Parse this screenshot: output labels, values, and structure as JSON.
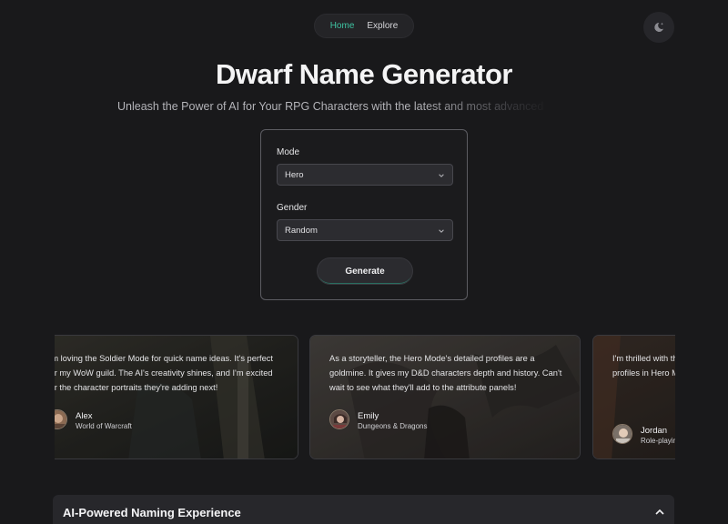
{
  "nav": {
    "links": [
      "Home",
      "Explore"
    ],
    "active": "Home"
  },
  "theme_toggle": {
    "icon": "moon-sparkle-icon"
  },
  "hero": {
    "title": "Dwarf Name Generator",
    "subtitle": "Unleash the Power of AI for Your RPG Characters with the latest and most advanced"
  },
  "form": {
    "mode_label": "Mode",
    "mode_value": "Hero",
    "gender_label": "Gender",
    "gender_value": "Random",
    "generate_label": "Generate"
  },
  "testimonials": [
    {
      "text": "I'm loving the Soldier Mode for quick name ideas. It's perfect for my WoW guild. The AI's creativity shines, and I'm excited for the character portraits they're adding next!",
      "name": "Alex",
      "source": "World of Warcraft"
    },
    {
      "text": "As a storyteller, the Hero Mode's detailed profiles are a goldmine. It gives my D&D characters depth and history. Can't wait to see what they'll add to the attribute panels!",
      "name": "Emily",
      "source": "Dungeons & Dragons"
    },
    {
      "text": "I'm thrilled with the customization. It's made custom names and profiles in Hero Mode a joy to my gameplay.",
      "name": "Jordan",
      "source": "Role-playing"
    }
  ],
  "accordion": {
    "title": "AI-Powered Naming Experience",
    "icon": "chevron-up-icon"
  },
  "colors": {
    "accent": "#3fc4a3",
    "background": "#19191b",
    "card_border": "#5c5c62"
  }
}
